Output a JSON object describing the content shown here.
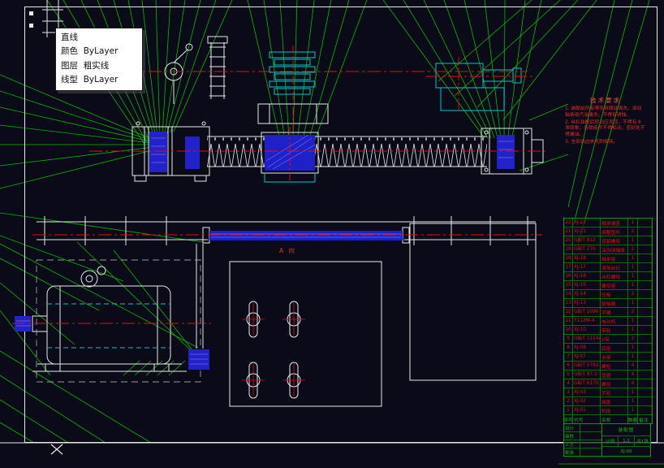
{
  "tooltip": {
    "entity": "直线",
    "color_label": "颜色",
    "color_value": "ByLayer",
    "layer_label": "图层",
    "layer_value": "粗实线",
    "linetype_label": "线型",
    "linetype_value": "ByLayer"
  },
  "view_label": "A 向",
  "tech_notes": {
    "title": "技术要求",
    "items": [
      "1. 装配前所有零件用煤油清洗，滚动轴承用汽油清洗，不得有锈蚀。",
      "2. 丝杠装配后转动应灵活，不得有卡滞现象；各联接件不得松动，密封处不得漏油。",
      "3. 全部锐边去毛刺倒钝。"
    ]
  },
  "bom": {
    "header": {
      "num": "序号",
      "code": "代号",
      "name": "名称",
      "qty": "数量",
      "note": "备注"
    },
    "rows": [
      {
        "num": "22",
        "code": "XJ-22",
        "name": "轴承端盖",
        "qty": "1",
        "note": ""
      },
      {
        "num": "21",
        "code": "XJ-21",
        "name": "调整垫片",
        "qty": "2",
        "note": ""
      },
      {
        "num": "20",
        "code": "GB/T 812",
        "name": "锁紧螺母",
        "qty": "1",
        "note": ""
      },
      {
        "num": "19",
        "code": "GB/T 276",
        "name": "深沟球轴承",
        "qty": "2",
        "note": ""
      },
      {
        "num": "18",
        "code": "XJ-18",
        "name": "轴承座",
        "qty": "1",
        "note": ""
      },
      {
        "num": "17",
        "code": "XJ-17",
        "name": "滚珠丝杠",
        "qty": "1",
        "note": ""
      },
      {
        "num": "16",
        "code": "XJ-16",
        "name": "丝杠螺母",
        "qty": "1",
        "note": ""
      },
      {
        "num": "15",
        "code": "XJ-15",
        "name": "螺母座",
        "qty": "1",
        "note": ""
      },
      {
        "num": "14",
        "code": "XJ-14",
        "name": "压板",
        "qty": "2",
        "note": ""
      },
      {
        "num": "13",
        "code": "XJ-13",
        "name": "联轴器",
        "qty": "1",
        "note": ""
      },
      {
        "num": "12",
        "code": "GB/T 1096",
        "name": "平键",
        "qty": "2",
        "note": ""
      },
      {
        "num": "11",
        "code": "Y112M-4",
        "name": "电动机",
        "qty": "1",
        "note": ""
      },
      {
        "num": "10",
        "code": "XJ-10",
        "name": "带轮",
        "qty": "1",
        "note": ""
      },
      {
        "num": "9",
        "code": "GB/T 11544",
        "name": "V带",
        "qty": "2",
        "note": ""
      },
      {
        "num": "8",
        "code": "XJ-08",
        "name": "底座",
        "qty": "1",
        "note": ""
      },
      {
        "num": "7",
        "code": "XJ-07",
        "name": "支架",
        "qty": "1",
        "note": ""
      },
      {
        "num": "6",
        "code": "GB/T 5782",
        "name": "螺栓",
        "qty": "4",
        "note": ""
      },
      {
        "num": "5",
        "code": "GB/T 97.1",
        "name": "垫圈",
        "qty": "4",
        "note": ""
      },
      {
        "num": "4",
        "code": "GB/T 6170",
        "name": "螺母",
        "qty": "4",
        "note": ""
      },
      {
        "num": "3",
        "code": "XJ-03",
        "name": "手轮",
        "qty": "1",
        "note": ""
      },
      {
        "num": "2",
        "code": "XJ-02",
        "name": "端盖",
        "qty": "1",
        "note": ""
      },
      {
        "num": "1",
        "code": "XJ-01",
        "name": "机座",
        "qty": "1",
        "note": ""
      }
    ]
  },
  "title_block": {
    "labels": [
      "设计",
      "审核",
      "工艺",
      "批准"
    ],
    "name": "装配图",
    "scale_label": "比例",
    "scale": "1:2",
    "sheet": "共1张",
    "code": "XJ-00"
  },
  "colors": {
    "background": "#0a0a18",
    "line_green": "#00c800",
    "entity_white": "#e8e8e8",
    "entity_cyan": "#00c8c8",
    "centerline_red": "#e01010",
    "detail_blue": "#2222c8"
  }
}
